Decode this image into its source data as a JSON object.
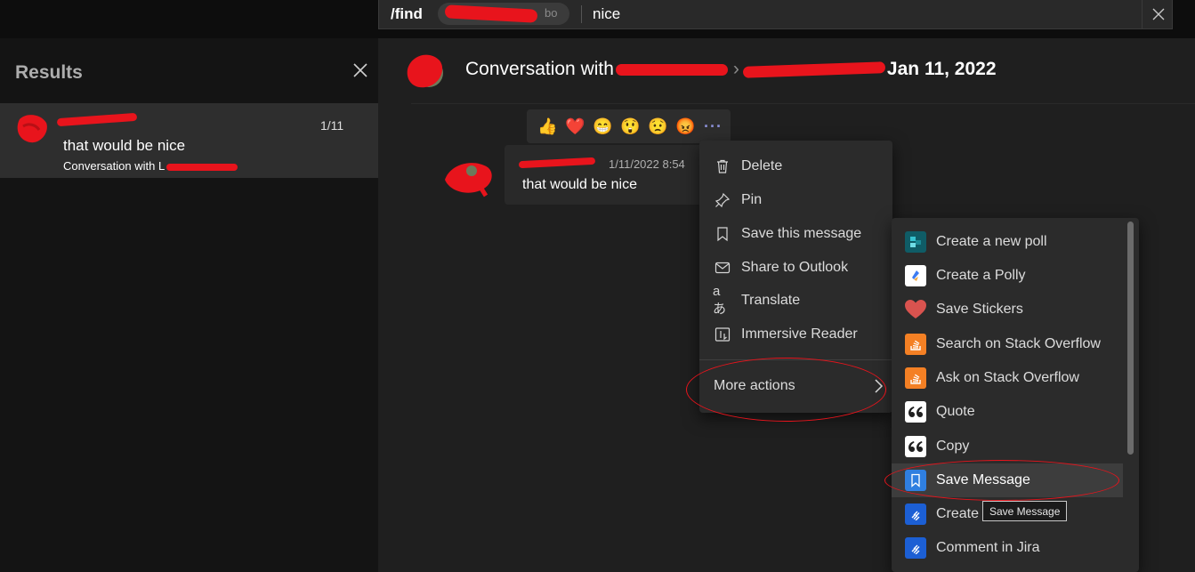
{
  "command_bar": {
    "prefix": "/find",
    "pill_text": "bo",
    "search_value": "nice"
  },
  "results": {
    "title": "Results",
    "items": [
      {
        "count": "1/11",
        "text": "that would be nice",
        "subtitle": "Conversation with L"
      }
    ]
  },
  "conversation": {
    "title_prefix": "Conversation with",
    "title_sep": "›",
    "date": "Jan 11, 2022"
  },
  "reactions": [
    {
      "icon": "thumbs-up-icon",
      "glyph": "👍"
    },
    {
      "icon": "heart-icon",
      "glyph": "❤️"
    },
    {
      "icon": "laugh-icon",
      "glyph": "😁"
    },
    {
      "icon": "surprised-icon",
      "glyph": "😲"
    },
    {
      "icon": "sad-icon",
      "glyph": "😟"
    },
    {
      "icon": "angry-icon",
      "glyph": "😡"
    }
  ],
  "message": {
    "time": "1/11/2022 8:54",
    "text": "that would be nice"
  },
  "context_menu": {
    "items": [
      {
        "label": "Delete",
        "icon": "trash-icon"
      },
      {
        "label": "Pin",
        "icon": "pin-icon"
      },
      {
        "label": "Save this message",
        "icon": "bookmark-icon"
      },
      {
        "label": "Share to Outlook",
        "icon": "mail-icon"
      },
      {
        "label": "Translate",
        "icon": "translate-icon"
      },
      {
        "label": "Immersive Reader",
        "icon": "immersive-reader-icon"
      }
    ],
    "more_actions": "More actions"
  },
  "more_actions_menu": {
    "items": [
      {
        "label": "Create a new poll",
        "icon": "forms-poll-icon",
        "color": "#0f6e74"
      },
      {
        "label": "Create a Polly",
        "icon": "polly-icon",
        "color": "#ffffff"
      },
      {
        "label": "Save Stickers",
        "icon": "heart-icon",
        "color": "#d9534f"
      },
      {
        "label": "Search on Stack Overflow",
        "icon": "stack-overflow-icon",
        "color": "#f48024"
      },
      {
        "label": "Ask on Stack Overflow",
        "icon": "stack-overflow-icon",
        "color": "#f48024"
      },
      {
        "label": "Quote",
        "icon": "quote-icon",
        "color": "#ffffff"
      },
      {
        "label": "Copy",
        "icon": "quote-icon",
        "color": "#ffffff"
      },
      {
        "label": "Save Message",
        "icon": "bookmark-icon",
        "color": "#2f7fe0"
      },
      {
        "label": "Create",
        "icon": "jira-icon",
        "color": "#1c5fd4"
      },
      {
        "label": "Comment in Jira",
        "icon": "jira-icon",
        "color": "#1c5fd4"
      }
    ],
    "highlighted": "Save Message"
  },
  "tooltip": "Save Message"
}
